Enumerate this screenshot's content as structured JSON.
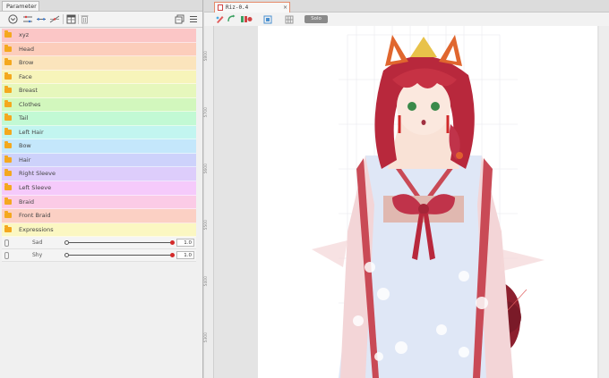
{
  "left_panel": {
    "tab_title": "Parameter",
    "toolbar_icons": [
      "chevron-circle-icon",
      "link-params-icon",
      "add-param-icon",
      "keyform-icon",
      "spreadsheet-icon",
      "trash-icon",
      "copy-panel-icon",
      "menu-icon"
    ],
    "groups": [
      {
        "label": "xyz",
        "color": "#fbc6c6"
      },
      {
        "label": "Head",
        "color": "#fccdbb"
      },
      {
        "label": "Brow",
        "color": "#fbe4bc"
      },
      {
        "label": "Face",
        "color": "#f7f4ba"
      },
      {
        "label": "Breast",
        "color": "#e6f7bc"
      },
      {
        "label": "Clothes",
        "color": "#d2f7bd"
      },
      {
        "label": "Tail",
        "color": "#c2f9d4"
      },
      {
        "label": "Left Hair",
        "color": "#c2f5f0"
      },
      {
        "label": "Bow",
        "color": "#c4e7fb"
      },
      {
        "label": "Hair",
        "color": "#cdd2fb"
      },
      {
        "label": "Right Sleeve",
        "color": "#ddcdfb"
      },
      {
        "label": "Left Sleeve",
        "color": "#f5cafb"
      },
      {
        "label": "Braid",
        "color": "#fbcbe6"
      },
      {
        "label": "Front Braid",
        "color": "#fbd0c4"
      },
      {
        "label": "Expressions",
        "color": "#fbf7c2"
      }
    ],
    "parameters": [
      {
        "label": "Sad",
        "value": "1.0"
      },
      {
        "label": "Shy",
        "value": "1.0"
      }
    ]
  },
  "editor": {
    "doc_tab_title": "Riz-0.4",
    "doc_tab_close": "×",
    "toolbar_icons": [
      "pen-tool-icon",
      "rotate-tool-icon",
      "color-swatches-icon",
      "fit-view-icon",
      "grid-icon"
    ],
    "solo_label": "Solo",
    "ruler_labels": [
      "5800",
      "5700",
      "5600",
      "5500",
      "5400",
      "5300"
    ]
  },
  "colors": {
    "accent_orange": "#e58a6a",
    "key_red": "#d42a2a",
    "folder": "#f4a81e"
  }
}
